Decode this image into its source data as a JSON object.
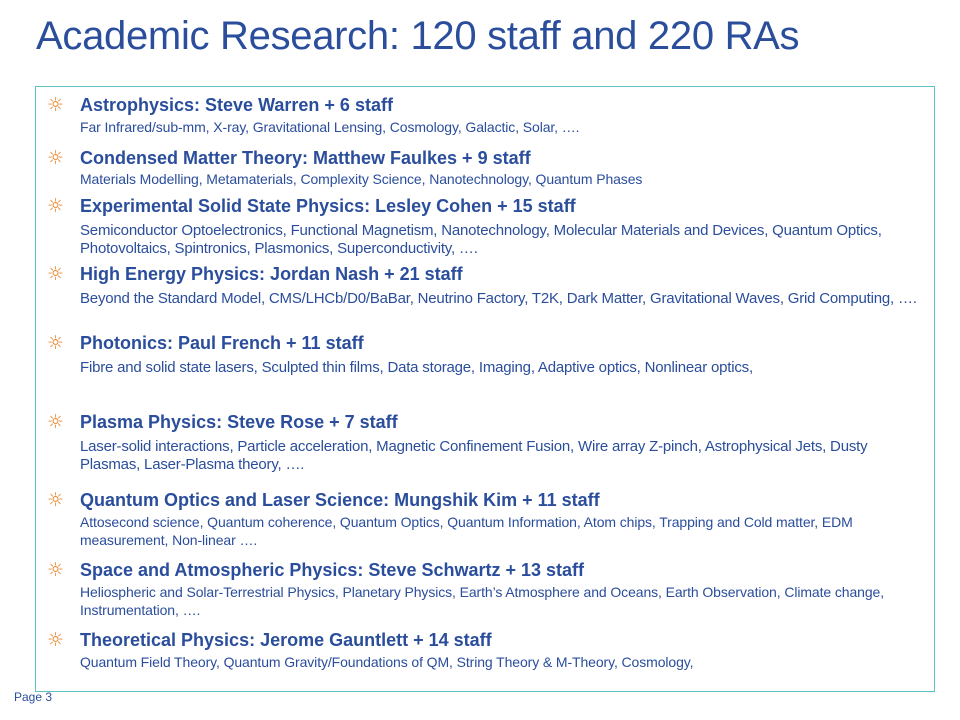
{
  "slide": {
    "title": "Academic Research: 120 staff and 220 RAs",
    "page_label": "Page 3",
    "bullet_glyph": "☼",
    "colors": {
      "text": "#2a4d9c",
      "bullet": "#e98a32",
      "border": "#5fc2c2"
    }
  },
  "groups": [
    {
      "heading": "Astrophysics: Steve Warren + 6 staff",
      "topics": "Far Infrared/sub-mm, X-ray, Gravitational Lensing, Cosmology, Galactic, Solar, …."
    },
    {
      "heading": "Condensed Matter Theory: Matthew Faulkes + 9 staff",
      "topics": "Materials Modelling, Metamaterials, Complexity Science, Nanotechnology, Quantum Phases"
    },
    {
      "heading": "Experimental Solid State Physics: Lesley Cohen + 15 staff",
      "topics": "Semiconductor Optoelectronics, Functional Magnetism, Nanotechnology, Molecular Materials and Devices, Quantum Optics, Photovoltaics, Spintronics, Plasmonics, Superconductivity, …."
    },
    {
      "heading": "High Energy Physics: Jordan Nash + 21 staff",
      "topics": "Beyond the Standard Model, CMS/LHCb/D0/BaBar, Neutrino Factory, T2K, Dark Matter, Gravitational Waves, Grid Computing, …."
    },
    {
      "heading": "Photonics: Paul French + 11 staff",
      "topics": "Fibre and solid state lasers, Sculpted thin films, Data storage, Imaging, Adaptive optics, Nonlinear optics,"
    },
    {
      "heading": "Plasma Physics: Steve Rose + 7 staff",
      "topics": "Laser-solid interactions, Particle acceleration, Magnetic Confinement Fusion, Wire array Z-pinch, Astrophysical Jets, Dusty Plasmas, Laser-Plasma theory, …."
    },
    {
      "heading": "Quantum Optics and Laser Science: Mungshik Kim + 11 staff",
      "topics": "Attosecond science, Quantum coherence, Quantum Optics, Quantum Information, Atom chips, Trapping and Cold matter, EDM measurement, Non-linear …."
    },
    {
      "heading": "Space and Atmospheric Physics: Steve Schwartz + 13 staff",
      "topics": "Heliospheric and Solar-Terrestrial Physics, Planetary Physics, Earth’s Atmosphere and Oceans, Earth Observation, Climate change, Instrumentation, …."
    },
    {
      "heading": "Theoretical Physics: Jerome Gauntlett + 14 staff",
      "topics": "Quantum Field Theory, Quantum Gravity/Foundations of QM, String Theory & M-Theory, Cosmology,"
    }
  ]
}
